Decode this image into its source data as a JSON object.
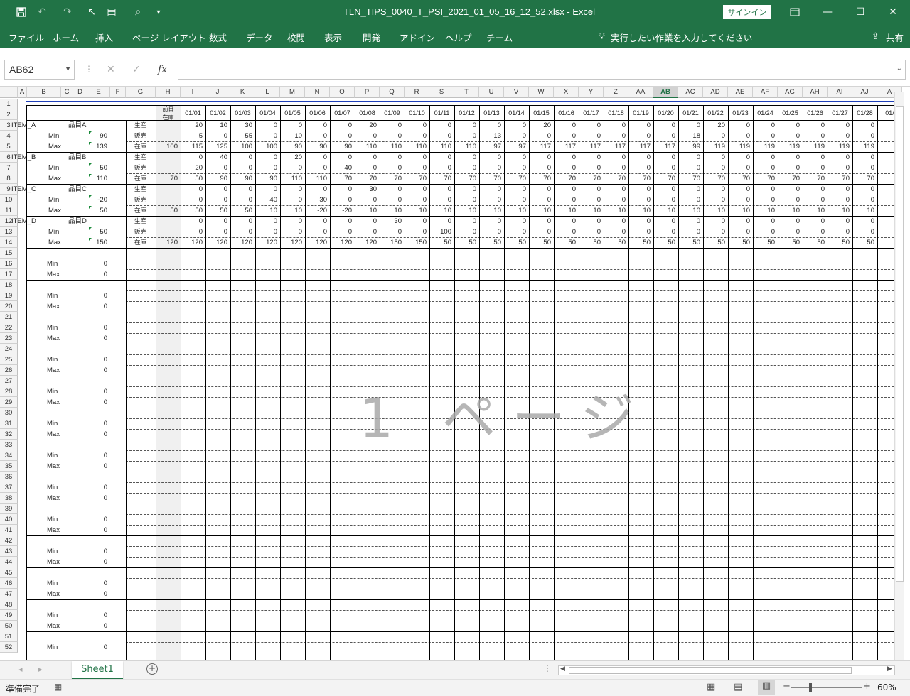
{
  "titlebar": {
    "title": "TLN_TIPS_0040_T_PSI_2021_01_05_16_12_52.xlsx  -  Excel",
    "signin": "サインイン"
  },
  "ribbon": {
    "tabs": [
      "ファイル",
      "ホーム",
      "挿入",
      "ページ レイアウト",
      "数式",
      "データ",
      "校閲",
      "表示",
      "開発",
      "アドイン",
      "ヘルプ",
      "チーム"
    ],
    "tellme": "実行したい作業を入力してください",
    "share": "共有"
  },
  "formula_bar": {
    "namebox": "AB62",
    "fx": "fx",
    "value": ""
  },
  "columns": [
    "A",
    "B",
    "C",
    "D",
    "E",
    "F",
    "G",
    "H",
    "I",
    "J",
    "K",
    "L",
    "M",
    "N",
    "O",
    "P",
    "Q",
    "R",
    "S",
    "T",
    "U",
    "V",
    "W",
    "X",
    "Y",
    "Z",
    "AA",
    "AB",
    "AC",
    "AD",
    "AE",
    "AF",
    "AG",
    "AH",
    "AI",
    "AJ",
    "A"
  ],
  "rows": [
    "1",
    "2",
    "3",
    "4",
    "5",
    "6",
    "7",
    "8",
    "9",
    "10",
    "11",
    "12",
    "13",
    "14",
    "15",
    "16",
    "17",
    "18",
    "19",
    "20",
    "21",
    "22",
    "23",
    "24",
    "25",
    "26",
    "27",
    "28",
    "29",
    "30",
    "31",
    "32",
    "33",
    "34",
    "35",
    "36",
    "37",
    "38",
    "39",
    "40",
    "41",
    "42",
    "43",
    "44",
    "45",
    "46",
    "47",
    "48",
    "49",
    "50",
    "51",
    "52"
  ],
  "header": {
    "prev_line1": "前日",
    "prev_line2": "在庫",
    "dates": [
      "01/01",
      "01/02",
      "01/03",
      "01/04",
      "01/05",
      "01/06",
      "01/07",
      "01/08",
      "01/09",
      "01/10",
      "01/11",
      "01/12",
      "01/13",
      "01/14",
      "01/15",
      "01/16",
      "01/17",
      "01/18",
      "01/19",
      "01/20",
      "01/21",
      "01/22",
      "01/23",
      "01/24",
      "01/25",
      "01/26",
      "01/27",
      "01/28",
      "01/"
    ]
  },
  "row_labels": [
    "生産",
    "販売",
    "在庫"
  ],
  "items": [
    {
      "code": "ITEM_A",
      "name": "品目A",
      "min": "90",
      "max": "139",
      "prev": "100",
      "prod": [
        "20",
        "10",
        "30",
        "0",
        "0",
        "0",
        "0",
        "20",
        "0",
        "0",
        "0",
        "0",
        "0",
        "0",
        "20",
        "0",
        "0",
        "0",
        "0",
        "0",
        "0",
        "20",
        "0",
        "0",
        "0",
        "0",
        "0",
        "0",
        ""
      ],
      "sales": [
        "5",
        "0",
        "55",
        "0",
        "10",
        "0",
        "0",
        "0",
        "0",
        "0",
        "0",
        "0",
        "13",
        "0",
        "0",
        "0",
        "0",
        "0",
        "0",
        "0",
        "18",
        "0",
        "0",
        "0",
        "0",
        "0",
        "0",
        "0",
        ""
      ],
      "stock": [
        "115",
        "125",
        "100",
        "100",
        "90",
        "90",
        "90",
        "110",
        "110",
        "110",
        "110",
        "110",
        "97",
        "97",
        "117",
        "117",
        "117",
        "117",
        "117",
        "117",
        "99",
        "119",
        "119",
        "119",
        "119",
        "119",
        "119",
        "119",
        "1"
      ]
    },
    {
      "code": "ITEM_B",
      "name": "品目B",
      "min": "50",
      "max": "110",
      "prev": "70",
      "prod": [
        "0",
        "40",
        "0",
        "0",
        "20",
        "0",
        "0",
        "0",
        "0",
        "0",
        "0",
        "0",
        "0",
        "0",
        "0",
        "0",
        "0",
        "0",
        "0",
        "0",
        "0",
        "0",
        "0",
        "0",
        "0",
        "0",
        "0",
        "0",
        ""
      ],
      "sales": [
        "20",
        "0",
        "0",
        "0",
        "0",
        "0",
        "40",
        "0",
        "0",
        "0",
        "0",
        "0",
        "0",
        "0",
        "0",
        "0",
        "0",
        "0",
        "0",
        "0",
        "0",
        "0",
        "0",
        "0",
        "0",
        "0",
        "0",
        "0",
        ""
      ],
      "stock": [
        "50",
        "90",
        "90",
        "90",
        "110",
        "110",
        "70",
        "70",
        "70",
        "70",
        "70",
        "70",
        "70",
        "70",
        "70",
        "70",
        "70",
        "70",
        "70",
        "70",
        "70",
        "70",
        "70",
        "70",
        "70",
        "70",
        "70",
        "70",
        ""
      ]
    },
    {
      "code": "ITEM_C",
      "name": "品目C",
      "min": "-20",
      "max": "50",
      "prev": "50",
      "prod": [
        "0",
        "0",
        "0",
        "0",
        "0",
        "0",
        "0",
        "30",
        "0",
        "0",
        "0",
        "0",
        "0",
        "0",
        "0",
        "0",
        "0",
        "0",
        "0",
        "0",
        "0",
        "0",
        "0",
        "0",
        "0",
        "0",
        "0",
        "0",
        ""
      ],
      "sales": [
        "0",
        "0",
        "0",
        "40",
        "0",
        "30",
        "0",
        "0",
        "0",
        "0",
        "0",
        "0",
        "0",
        "0",
        "0",
        "0",
        "0",
        "0",
        "0",
        "0",
        "0",
        "0",
        "0",
        "0",
        "0",
        "0",
        "0",
        "0",
        ""
      ],
      "stock": [
        "50",
        "50",
        "50",
        "10",
        "10",
        "-20",
        "-20",
        "10",
        "10",
        "10",
        "10",
        "10",
        "10",
        "10",
        "10",
        "10",
        "10",
        "10",
        "10",
        "10",
        "10",
        "10",
        "10",
        "10",
        "10",
        "10",
        "10",
        "10",
        ""
      ]
    },
    {
      "code": "ITEM_D",
      "name": "品目D",
      "min": "50",
      "max": "150",
      "prev": "120",
      "prod": [
        "0",
        "0",
        "0",
        "0",
        "0",
        "0",
        "0",
        "0",
        "30",
        "0",
        "0",
        "0",
        "0",
        "0",
        "0",
        "0",
        "0",
        "0",
        "0",
        "0",
        "0",
        "0",
        "0",
        "0",
        "0",
        "0",
        "0",
        "0",
        ""
      ],
      "sales": [
        "0",
        "0",
        "0",
        "0",
        "0",
        "0",
        "0",
        "0",
        "0",
        "0",
        "100",
        "0",
        "0",
        "0",
        "0",
        "0",
        "0",
        "0",
        "0",
        "0",
        "0",
        "0",
        "0",
        "0",
        "0",
        "0",
        "0",
        "0",
        ""
      ],
      "stock": [
        "120",
        "120",
        "120",
        "120",
        "120",
        "120",
        "120",
        "120",
        "150",
        "150",
        "50",
        "50",
        "50",
        "50",
        "50",
        "50",
        "50",
        "50",
        "50",
        "50",
        "50",
        "50",
        "50",
        "50",
        "50",
        "50",
        "50",
        "50",
        ""
      ]
    }
  ],
  "empty_block": {
    "min_label": "Min",
    "max_label": "Max",
    "value": "0"
  },
  "watermark": "1 ページ",
  "sheet_tab": "Sheet1",
  "status": {
    "ready": "準備完了",
    "zoom": "60%"
  }
}
